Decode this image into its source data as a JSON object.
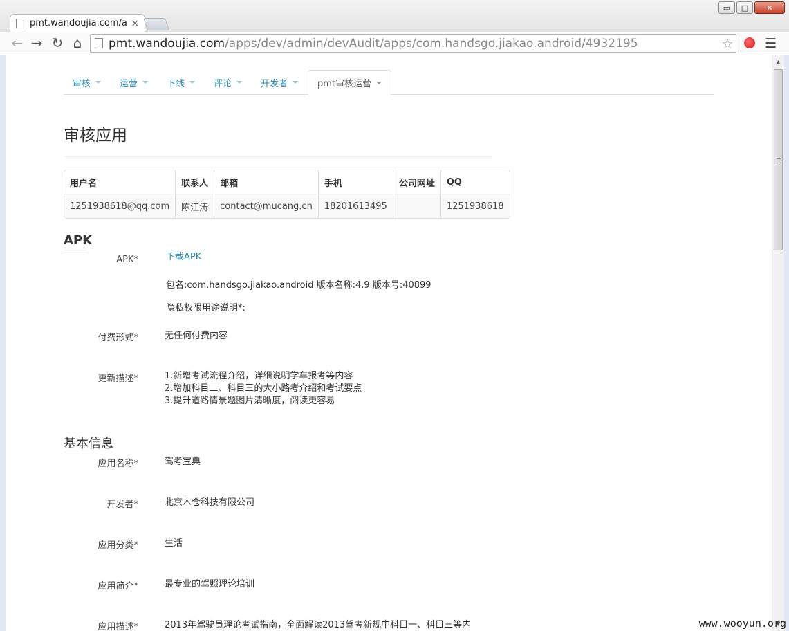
{
  "browser": {
    "tab_title": "pmt.wandoujia.com/apps/",
    "tab_close": "×",
    "url_host": "pmt.wandoujia.com",
    "url_path": "/apps/dev/admin/devAudit/apps/com.handsgo.jiakao.android/4932195",
    "window_controls": {
      "minimize": "▭",
      "maximize": "□",
      "close": "✕"
    }
  },
  "nav": {
    "tabs": [
      {
        "label": "审核"
      },
      {
        "label": "运营"
      },
      {
        "label": "下线"
      },
      {
        "label": "评论"
      },
      {
        "label": "开发者"
      },
      {
        "label": "pmt审核运营"
      }
    ],
    "active_tab": "pmt审核运营"
  },
  "page": {
    "title": "审核应用"
  },
  "user_table": {
    "headers": [
      "用户名",
      "联系人",
      "邮箱",
      "手机",
      "公司网址",
      "QQ"
    ],
    "rows": [
      [
        "1251938618@qq.com",
        "陈江涛",
        "contact@mucang.cn",
        "18201613495",
        "",
        "1251938618"
      ]
    ]
  },
  "apk_section": {
    "heading": "APK",
    "apk_label": "APK*",
    "download_link": "下载APK",
    "package_info": "包名:com.handsgo.jiakao.android 版本名称:4.9 版本号:40899",
    "privacy_label": "隐私权限用途说明*:",
    "payment_label": "付费形式*",
    "payment_value": "无任何付费内容",
    "update_label": "更新描述*",
    "update_lines": [
      "1.新增考试流程介绍，详细说明学车报考等内容",
      "2.增加科目二、科目三的大小路考介绍和考试要点",
      "3.提升道路情景题图片清晰度，阅读更容易"
    ]
  },
  "basic_info": {
    "heading": "基本信息",
    "app_name_label": "应用名称*",
    "app_name": "驾考宝典",
    "developer_label": "开发者*",
    "developer": "北京木仓科技有限公司",
    "category_label": "应用分类*",
    "category": "生活",
    "summary_label": "应用简介*",
    "summary": "最专业的驾照理论培训",
    "description_label": "应用描述*",
    "description": "2013年驾驶员理论考试指南，全面解读2013驾考新规中科目一、科目三等内"
  },
  "watermark": "www.wooyun.org"
}
